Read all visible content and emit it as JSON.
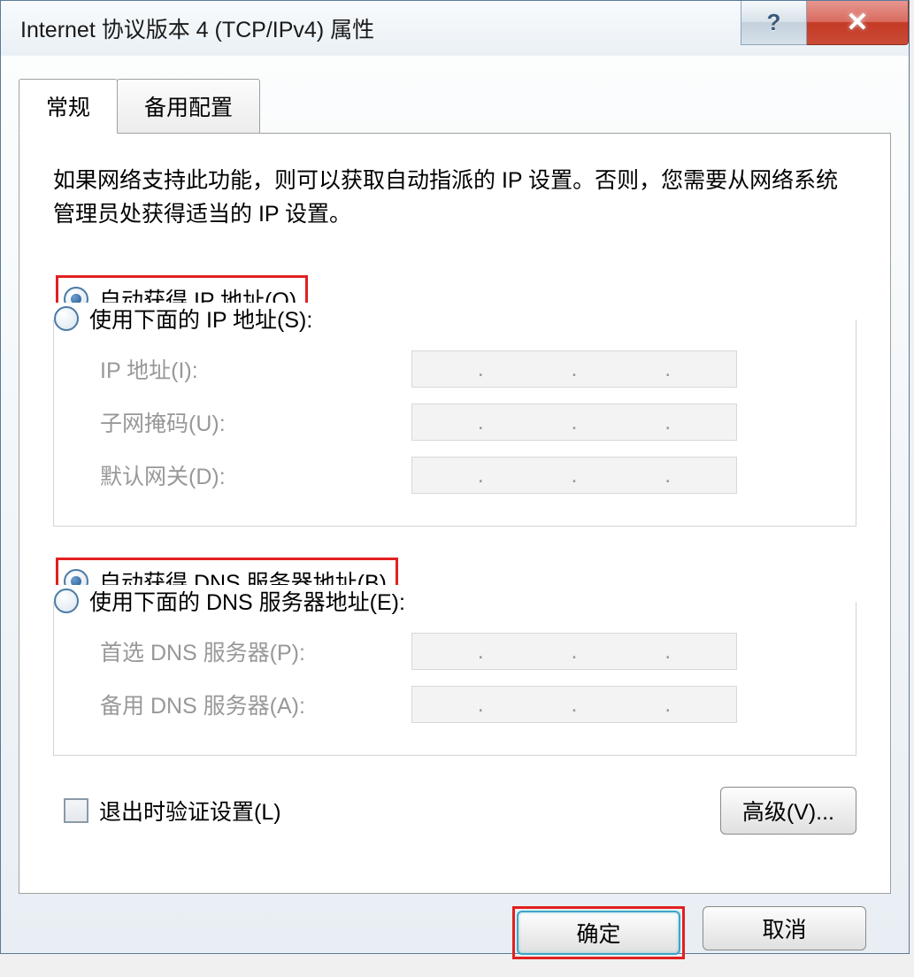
{
  "window": {
    "title": "Internet 协议版本 4 (TCP/IPv4) 属性",
    "help_symbol": "?",
    "close_symbol": "✕"
  },
  "tabs": {
    "general": "常规",
    "alternate": "备用配置"
  },
  "description": "如果网络支持此功能，则可以获取自动指派的 IP 设置。否则，您需要从网络系统管理员处获得适当的 IP 设置。",
  "ip_section": {
    "auto_label": "自动获得 IP 地址(O)",
    "manual_label": "使用下面的 IP 地址(S):",
    "ip_address_label": "IP 地址(I):",
    "subnet_mask_label": "子网掩码(U):",
    "default_gateway_label": "默认网关(D):"
  },
  "dns_section": {
    "auto_label": "自动获得 DNS 服务器地址(B)",
    "manual_label": "使用下面的 DNS 服务器地址(E):",
    "preferred_dns_label": "首选 DNS 服务器(P):",
    "alternate_dns_label": "备用 DNS 服务器(A):"
  },
  "validate_checkbox_label": "退出时验证设置(L)",
  "advanced_button_label": "高级(V)...",
  "ok_button_label": "确定",
  "cancel_button_label": "取消"
}
